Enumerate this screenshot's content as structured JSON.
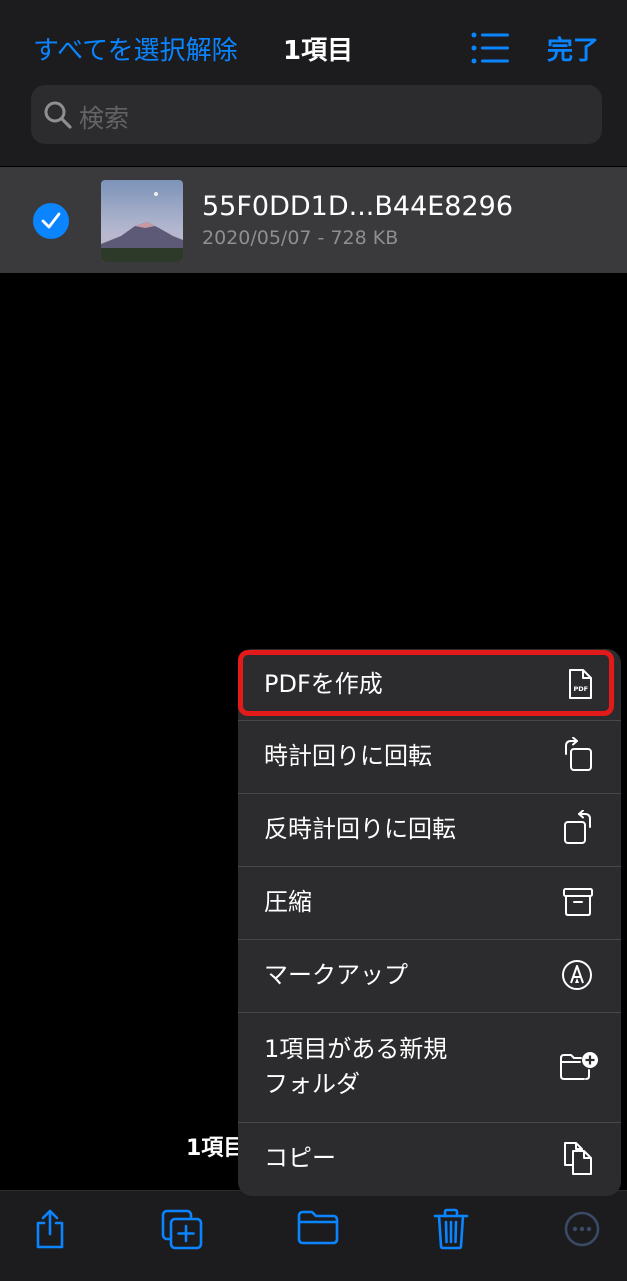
{
  "nav": {
    "deselect_all": "すべてを選択解除",
    "title": "1項目",
    "done": "完了"
  },
  "search": {
    "placeholder": "検索"
  },
  "file": {
    "name": "55F0DD1D...B44E8296",
    "meta": "2020/05/07 - 728 KB",
    "selected": true
  },
  "bottom_count": "1項目",
  "menu": {
    "items": [
      {
        "label": "PDFを作成",
        "icon": "pdf-doc-icon",
        "highlighted": true
      },
      {
        "label": "時計回りに回転",
        "icon": "rotate-right-icon"
      },
      {
        "label": "反時計回りに回転",
        "icon": "rotate-left-icon"
      },
      {
        "label": "圧縮",
        "icon": "archive-box-icon"
      },
      {
        "label": "マークアップ",
        "icon": "markup-pen-icon"
      },
      {
        "label": "1項目がある新規\nフォルダ",
        "icon": "new-folder-icon"
      },
      {
        "label": "コピー",
        "icon": "copy-docs-icon"
      }
    ],
    "pdf_icon_text": "PDF"
  },
  "toolbar": {
    "items": [
      "share-icon",
      "duplicate-icon",
      "move-folder-icon",
      "trash-icon",
      "more-icon"
    ]
  },
  "colors": {
    "accent": "#0a84ff",
    "highlight": "#e21a1a"
  }
}
